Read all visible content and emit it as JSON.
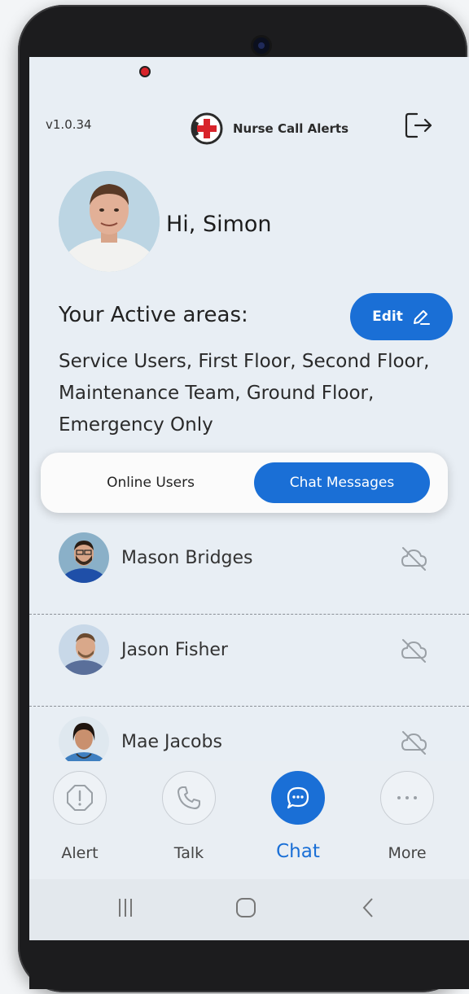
{
  "app": {
    "version": "v1.0.34",
    "title": "Nurse Call Alerts",
    "logout_icon": "logout-icon"
  },
  "user": {
    "greeting": "Hi, Simon"
  },
  "active_areas": {
    "label": "Your Active areas:",
    "edit_label": "Edit",
    "text": "Service Users, First Floor, Second Floor, Maintenance Team, Ground Floor, Emergency Only"
  },
  "tabs": {
    "online": "Online Users",
    "chat": "Chat Messages",
    "selected": "Chat Messages"
  },
  "users": [
    {
      "name": "Mason Bridges",
      "status_icon": "offline-cloud-icon"
    },
    {
      "name": "Jason Fisher",
      "status_icon": "offline-cloud-icon"
    },
    {
      "name": "Mae Jacobs",
      "status_icon": "offline-cloud-icon"
    }
  ],
  "nav": {
    "alert": "Alert",
    "talk": "Talk",
    "chat": "Chat",
    "more": "More",
    "active": "Chat"
  },
  "colors": {
    "accent": "#1a6fd6",
    "background": "#e8eef4",
    "brand_red": "#d8232a"
  }
}
